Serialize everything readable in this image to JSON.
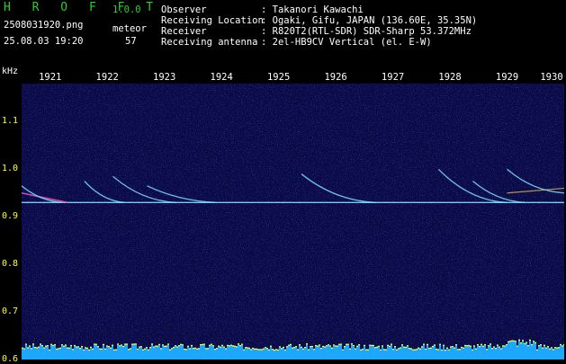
{
  "app": {
    "name": "H R O F F T",
    "version": "1.0.0",
    "filename": "2508031920.png",
    "datetime": "25.08.03 19:20",
    "count_label": "meteor",
    "count_value": "57"
  },
  "info": [
    {
      "key": "Observer",
      "value": ": Takanori Kawachi"
    },
    {
      "key": "Receiving Location",
      "value": ": Ogaki, Gifu, JAPAN (136.60E, 35.35N)"
    },
    {
      "key": "Receiver",
      "value": ": R820T2(RTL-SDR) SDR-Sharp 53.372MHz"
    },
    {
      "key": "Receiving antenna",
      "value": ": 2el-HB9CV Vertical (el. E-W)"
    }
  ],
  "colors": {
    "background": "#000000",
    "spectrum_bg": "#0a0a46",
    "signal": "#7fe3ff",
    "bars": "#1ea7ff",
    "bar_peak": "#ffff33",
    "tick_label": "#ffff33",
    "title": "#2ecc2e"
  },
  "chart_data": {
    "type": "heatmap",
    "xlabel": "",
    "ylabel": "kHz",
    "x_ticks": [
      "1921",
      "1922",
      "1923",
      "1924",
      "1925",
      "1926",
      "1927",
      "1928",
      "1929",
      "1930"
    ],
    "y_ticks": [
      "1.1",
      "1.0",
      "0.9",
      "0.8",
      "0.7",
      "0.6"
    ],
    "xlim": [
      1920.5,
      1930
    ],
    "ylim": [
      0.6,
      1.18
    ],
    "carrier_khz": 0.93,
    "carrier_khz_secondary": 0.95,
    "meteor_traces": [
      {
        "t0": 1920.5,
        "t1": 1921.2,
        "f0": 0.965,
        "f1": 0.93
      },
      {
        "t0": 1921.6,
        "t1": 1922.3,
        "f0": 0.975,
        "f1": 0.93
      },
      {
        "t0": 1922.1,
        "t1": 1923.2,
        "f0": 0.985,
        "f1": 0.93
      },
      {
        "t0": 1922.7,
        "t1": 1923.9,
        "f0": 0.965,
        "f1": 0.93
      },
      {
        "t0": 1925.4,
        "t1": 1926.7,
        "f0": 0.99,
        "f1": 0.93
      },
      {
        "t0": 1927.8,
        "t1": 1929.0,
        "f0": 1.0,
        "f1": 0.93
      },
      {
        "t0": 1928.4,
        "t1": 1929.3,
        "f0": 0.975,
        "f1": 0.93
      },
      {
        "t0": 1929.0,
        "t1": 1930.0,
        "f0": 1.0,
        "f1": 0.95
      }
    ],
    "bar_level": 0.55,
    "bar_peak_region": [
      1928.9,
      1929.5
    ]
  }
}
